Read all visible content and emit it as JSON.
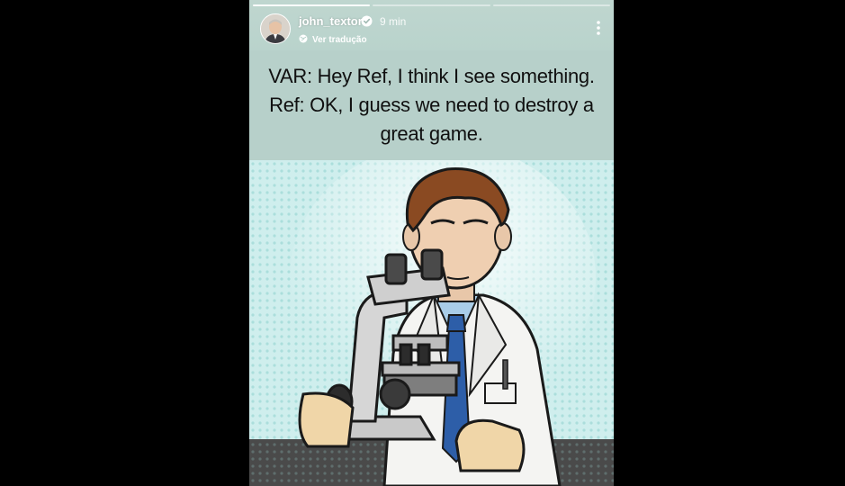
{
  "story": {
    "username": "john_textor",
    "time": "9 min",
    "translate_label": "Ver tradução",
    "progress_segments": 3,
    "active_segment": 0
  },
  "caption": {
    "line1": "VAR: Hey Ref, I think I see something.",
    "line2": "Ref: OK, I guess we need to destroy a",
    "line3": "great game."
  },
  "icons": {
    "verified": "verified-badge-icon",
    "translate": "globe-icon",
    "more": "more-vertical-icon"
  },
  "colors": {
    "background": "#000000",
    "header": "#bfd6cf",
    "caption_bg": "#b7d0ca",
    "illustration_bg": "#cfeeed",
    "coat": "#f4f4f2",
    "tie": "#2d5ea8"
  }
}
